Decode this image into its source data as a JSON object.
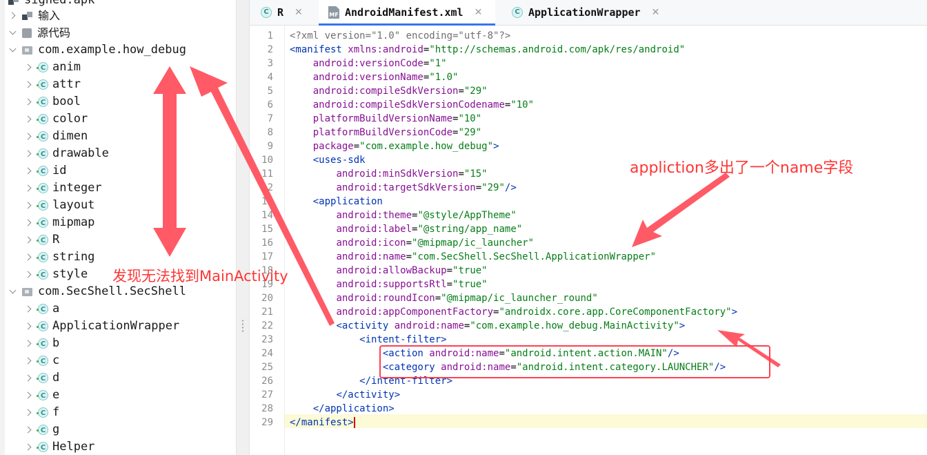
{
  "tree": {
    "top_partial_label": "signed.apk",
    "items": [
      {
        "label": "输入",
        "icon": "input-folder-icon",
        "expanded": false,
        "level": 0
      },
      {
        "label": "源代码",
        "icon": "source-code-icon",
        "expanded": true,
        "level": 0
      },
      {
        "label": "com.example.how_debug",
        "icon": "package-icon",
        "expanded": true,
        "level": 1
      },
      {
        "label": "anim",
        "icon": "class-icon",
        "level": 2
      },
      {
        "label": "attr",
        "icon": "class-icon",
        "level": 2
      },
      {
        "label": "bool",
        "icon": "class-icon",
        "level": 2
      },
      {
        "label": "color",
        "icon": "class-icon",
        "level": 2
      },
      {
        "label": "dimen",
        "icon": "class-icon",
        "level": 2
      },
      {
        "label": "drawable",
        "icon": "class-icon",
        "level": 2
      },
      {
        "label": "id",
        "icon": "class-icon",
        "level": 2
      },
      {
        "label": "integer",
        "icon": "class-icon",
        "level": 2
      },
      {
        "label": "layout",
        "icon": "class-icon",
        "level": 2
      },
      {
        "label": "mipmap",
        "icon": "class-icon",
        "level": 2
      },
      {
        "label": "R",
        "icon": "class-icon",
        "level": 2
      },
      {
        "label": "string",
        "icon": "class-icon",
        "level": 2
      },
      {
        "label": "style",
        "icon": "class-icon",
        "level": 2
      },
      {
        "label": "com.SecShell.SecShell",
        "icon": "package-icon",
        "expanded": true,
        "level": 1
      },
      {
        "label": "a",
        "icon": "class-icon",
        "level": 2
      },
      {
        "label": "ApplicationWrapper",
        "icon": "class-icon",
        "level": 2
      },
      {
        "label": "b",
        "icon": "class-icon",
        "level": 2
      },
      {
        "label": "c",
        "icon": "class-icon",
        "level": 2
      },
      {
        "label": "d",
        "icon": "class-icon",
        "level": 2
      },
      {
        "label": "e",
        "icon": "class-icon",
        "level": 2
      },
      {
        "label": "f",
        "icon": "class-icon",
        "level": 2
      },
      {
        "label": "g",
        "icon": "class-icon",
        "level": 2
      },
      {
        "label": "Helper",
        "icon": "class-icon",
        "level": 2
      }
    ]
  },
  "tabs": [
    {
      "label": "R",
      "icon": "class-icon",
      "active": false,
      "close": "✕"
    },
    {
      "label": "AndroidManifest.xml",
      "icon": "manifest-file-icon",
      "icon_text": "MF",
      "active": true,
      "close": "✕"
    },
    {
      "label": "ApplicationWrapper",
      "icon": "class-icon",
      "active": false,
      "close": "✕"
    }
  ],
  "class_icon_letter": "C",
  "editor": {
    "current_line": 29,
    "lines": [
      [
        [
          "pi",
          "<?xml version=\"1.0\" encoding=\"utf-8\"?>"
        ]
      ],
      [
        [
          "tag",
          "<manifest "
        ],
        [
          "ns",
          "xmlns:android"
        ],
        [
          "plain",
          "="
        ],
        [
          "val",
          "\"http://schemas.android.com/apk/res/android\""
        ]
      ],
      [
        [
          "plain",
          "    "
        ],
        [
          "ns",
          "android:versionCode"
        ],
        [
          "plain",
          "="
        ],
        [
          "val",
          "\"1\""
        ]
      ],
      [
        [
          "plain",
          "    "
        ],
        [
          "ns",
          "android:versionName"
        ],
        [
          "plain",
          "="
        ],
        [
          "val",
          "\"1.0\""
        ]
      ],
      [
        [
          "plain",
          "    "
        ],
        [
          "ns",
          "android:compileSdkVersion"
        ],
        [
          "plain",
          "="
        ],
        [
          "val",
          "\"29\""
        ]
      ],
      [
        [
          "plain",
          "    "
        ],
        [
          "ns",
          "android:compileSdkVersionCodename"
        ],
        [
          "plain",
          "="
        ],
        [
          "val",
          "\"10\""
        ]
      ],
      [
        [
          "plain",
          "    "
        ],
        [
          "ns",
          "platformBuildVersionName"
        ],
        [
          "plain",
          "="
        ],
        [
          "val",
          "\"10\""
        ]
      ],
      [
        [
          "plain",
          "    "
        ],
        [
          "ns",
          "platformBuildVersionCode"
        ],
        [
          "plain",
          "="
        ],
        [
          "val",
          "\"29\""
        ]
      ],
      [
        [
          "plain",
          "    "
        ],
        [
          "ns",
          "package"
        ],
        [
          "plain",
          "="
        ],
        [
          "val",
          "\"com.example.how_debug\""
        ],
        [
          "tag",
          ">"
        ]
      ],
      [
        [
          "plain",
          "    "
        ],
        [
          "tag",
          "<uses-sdk"
        ]
      ],
      [
        [
          "plain",
          "        "
        ],
        [
          "ns",
          "android:minSdkVersion"
        ],
        [
          "plain",
          "="
        ],
        [
          "val",
          "\"15\""
        ]
      ],
      [
        [
          "plain",
          "        "
        ],
        [
          "ns",
          "android:targetSdkVersion"
        ],
        [
          "plain",
          "="
        ],
        [
          "val",
          "\"29\""
        ],
        [
          "tag",
          "/>"
        ]
      ],
      [
        [
          "plain",
          "    "
        ],
        [
          "tag",
          "<application"
        ]
      ],
      [
        [
          "plain",
          "        "
        ],
        [
          "ns",
          "android:theme"
        ],
        [
          "plain",
          "="
        ],
        [
          "val",
          "\"@style/AppTheme\""
        ]
      ],
      [
        [
          "plain",
          "        "
        ],
        [
          "ns",
          "android:label"
        ],
        [
          "plain",
          "="
        ],
        [
          "val",
          "\"@string/app_name\""
        ]
      ],
      [
        [
          "plain",
          "        "
        ],
        [
          "ns",
          "android:icon"
        ],
        [
          "plain",
          "="
        ],
        [
          "val",
          "\"@mipmap/ic_launcher\""
        ]
      ],
      [
        [
          "plain",
          "        "
        ],
        [
          "ns",
          "android:name"
        ],
        [
          "plain",
          "="
        ],
        [
          "val",
          "\"com.SecShell.SecShell.ApplicationWrapper\""
        ]
      ],
      [
        [
          "plain",
          "        "
        ],
        [
          "ns",
          "android:allowBackup"
        ],
        [
          "plain",
          "="
        ],
        [
          "val",
          "\"true\""
        ]
      ],
      [
        [
          "plain",
          "        "
        ],
        [
          "ns",
          "android:supportsRtl"
        ],
        [
          "plain",
          "="
        ],
        [
          "val",
          "\"true\""
        ]
      ],
      [
        [
          "plain",
          "        "
        ],
        [
          "ns",
          "android:roundIcon"
        ],
        [
          "plain",
          "="
        ],
        [
          "val",
          "\"@mipmap/ic_launcher_round\""
        ]
      ],
      [
        [
          "plain",
          "        "
        ],
        [
          "ns",
          "android:appComponentFactory"
        ],
        [
          "plain",
          "="
        ],
        [
          "val",
          "\"androidx.core.app.CoreComponentFactory\""
        ],
        [
          "tag",
          ">"
        ]
      ],
      [
        [
          "plain",
          "        "
        ],
        [
          "tag",
          "<activity "
        ],
        [
          "ns",
          "android:name"
        ],
        [
          "plain",
          "="
        ],
        [
          "val",
          "\"com.example.how_debug.MainActivity\""
        ],
        [
          "tag",
          ">"
        ]
      ],
      [
        [
          "plain",
          "            "
        ],
        [
          "tag",
          "<intent-filter>"
        ]
      ],
      [
        [
          "plain",
          "                "
        ],
        [
          "tag",
          "<action "
        ],
        [
          "ns",
          "android:name"
        ],
        [
          "plain",
          "="
        ],
        [
          "val",
          "\"android.intent.action.MAIN\""
        ],
        [
          "tag",
          "/>"
        ]
      ],
      [
        [
          "plain",
          "                "
        ],
        [
          "tag",
          "<category "
        ],
        [
          "ns",
          "android:name"
        ],
        [
          "plain",
          "="
        ],
        [
          "val",
          "\"android.intent.category.LAUNCHER\""
        ],
        [
          "tag",
          "/>"
        ]
      ],
      [
        [
          "plain",
          "            "
        ],
        [
          "tag",
          "</intent-filter>"
        ]
      ],
      [
        [
          "plain",
          "        "
        ],
        [
          "tag",
          "</activity>"
        ]
      ],
      [
        [
          "plain",
          "    "
        ],
        [
          "tag",
          "</application>"
        ]
      ],
      [
        [
          "tag",
          "</manifest>"
        ]
      ]
    ]
  },
  "annotations": {
    "note_right": "appliction多出了一个name字段",
    "note_left": "发现无法找到MainActivity",
    "color": "#ff4a5a"
  }
}
